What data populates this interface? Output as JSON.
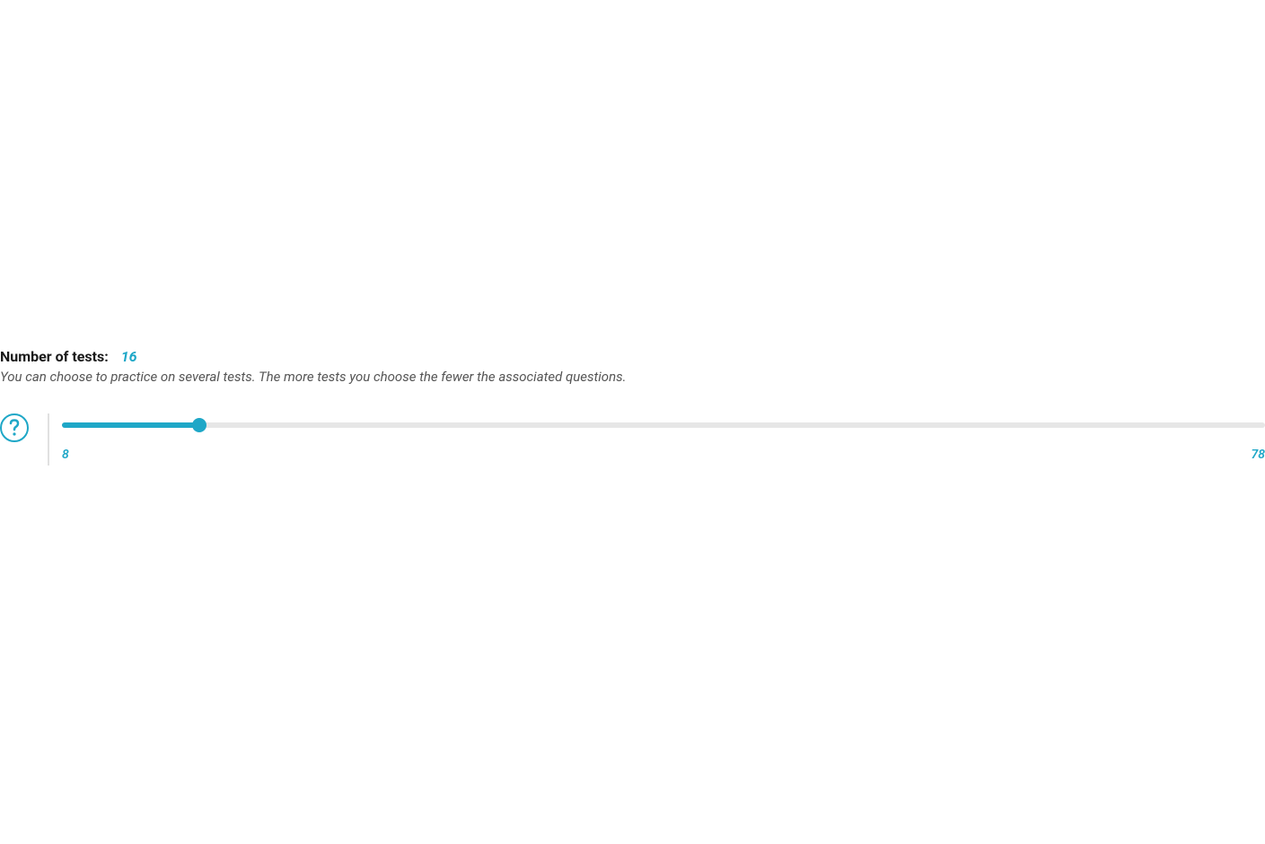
{
  "heading": {
    "label": "Number of tests:",
    "value": "16"
  },
  "description": "You can choose to practice on several tests. The more tests you choose the fewer the associated questions.",
  "slider": {
    "min": 8,
    "max": 78,
    "current": 16,
    "min_label": "8",
    "max_label": "78"
  },
  "colors": {
    "accent": "#1ea7c7"
  }
}
